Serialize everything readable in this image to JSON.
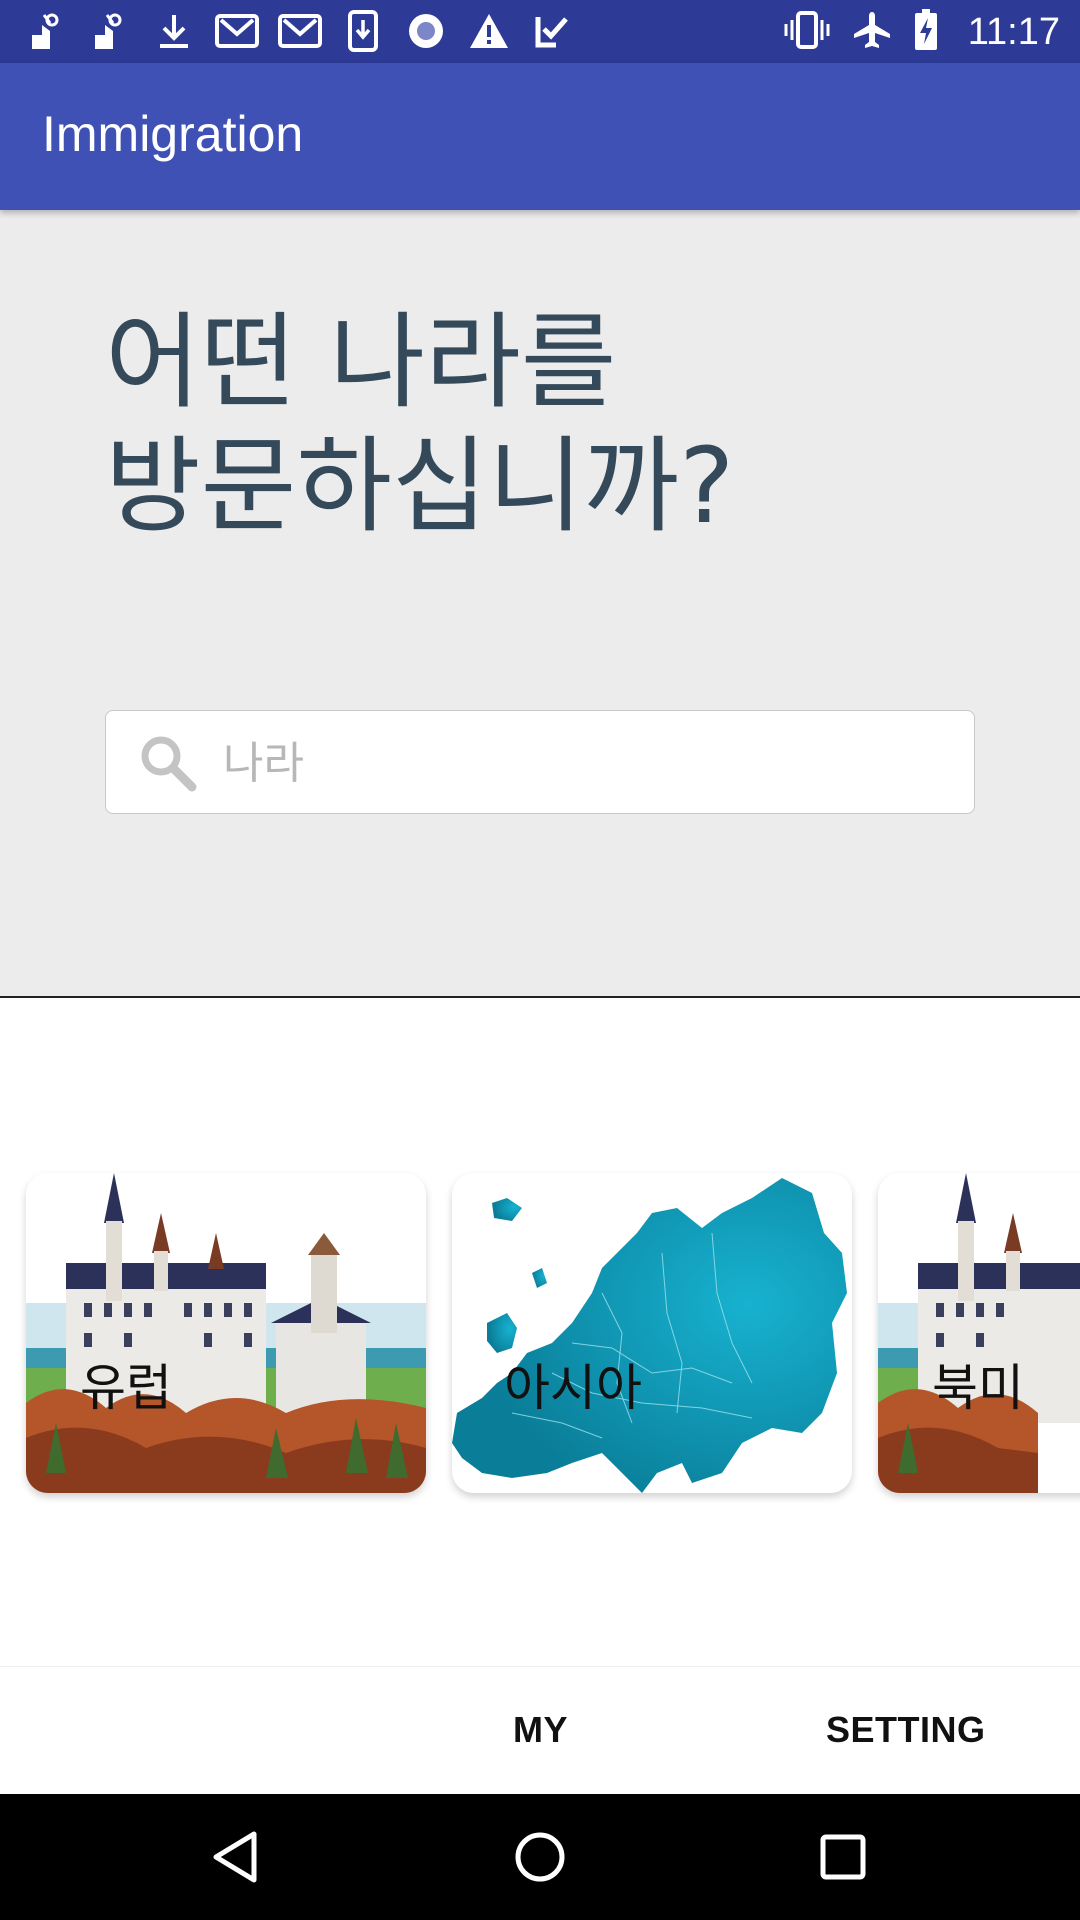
{
  "status_bar": {
    "time": "11:17",
    "left_icons": [
      "app-notification-icon",
      "app-notification-icon",
      "download-icon",
      "gmail-icon",
      "gmail-icon",
      "download-file-icon",
      "record-icon",
      "warning-icon",
      "task-check-icon"
    ],
    "right_icons": [
      "vibrate-icon",
      "airplane-mode-icon",
      "battery-charging-icon"
    ]
  },
  "app_bar": {
    "title": "Immigration"
  },
  "hero": {
    "headline_line1": "어떤 나라를",
    "headline_line2": "방문하십니까?"
  },
  "search": {
    "placeholder": "나라",
    "value": ""
  },
  "cards": [
    {
      "label": "유럽",
      "image": "castle-painting"
    },
    {
      "label": "아시아",
      "image": "europe-map"
    },
    {
      "label": "북미",
      "image": "castle-painting"
    }
  ],
  "tabs": {
    "my": "MY",
    "setting": "SETTING"
  },
  "nav": {
    "back": "back-icon",
    "home": "home-icon",
    "recents": "recents-icon"
  },
  "colors": {
    "status_bar": "#2d3b97",
    "app_bar": "#3f51b5",
    "hero_bg": "#ececec",
    "headline": "#34495a",
    "map_teal": "#0a8aa5"
  }
}
